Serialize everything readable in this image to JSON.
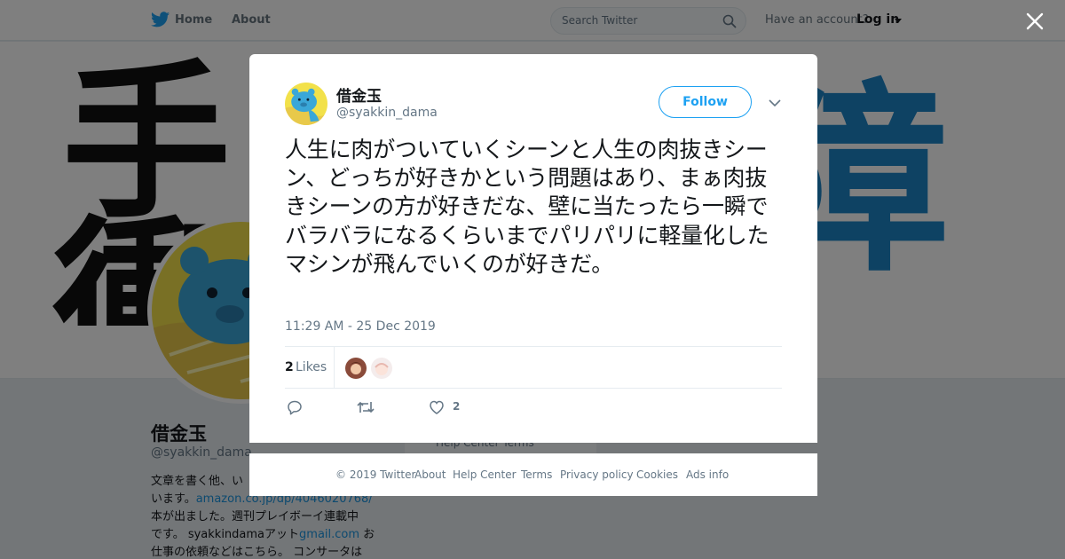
{
  "nav": {
    "home": "Home",
    "about": "About",
    "search_placeholder": "Search Twitter",
    "have_account": "Have an account?",
    "login": "Log in"
  },
  "banner": {
    "k1": "手",
    "k2": "衝",
    "k3": "障"
  },
  "profile": {
    "name": "借金玉",
    "handle": "@syakkin_dama",
    "bio_1": "文章を書く他、い",
    "bio_2": "います。",
    "bio_link": "amazon.co.jp/dp/4046020768/",
    "bio_3": "本が出ました。週刊プレイボーイ連載中",
    "bio_4": "です。 syakkindamaアット",
    "bio_mail": "gmail.com",
    "bio_5": " お",
    "bio_6": "仕事の依頼などはこちら。 コンサータは",
    "help_card": "Help Center   Terms"
  },
  "tweet": {
    "name": "借金玉",
    "handle": "@syakkin_dama",
    "follow": "Follow",
    "text": "人生に肉がついていくシーンと人生の肉抜きシーン、どっちが好きかという問題はあり、まぁ肉抜きシーンの方が好きだな、壁に当たったら一瞬でバラバラになるくらいまでパリパリに軽量化したマシンが飛んでいくのが好きだ。",
    "timestamp": "11:29 AM - 25 Dec 2019",
    "likes_count": "2",
    "likes_label": "Likes",
    "heart_count": "2"
  },
  "footer": {
    "copyright": "© 2019 Twitter",
    "about": "About",
    "help": "Help Center",
    "terms": "Terms",
    "privacy": "Privacy policy",
    "cookies": "Cookies",
    "ads": "Ads info"
  },
  "colors": {
    "accent": "#1da1f2",
    "muted": "#657786",
    "overlay": "rgba(0,0,0,0.5)"
  }
}
